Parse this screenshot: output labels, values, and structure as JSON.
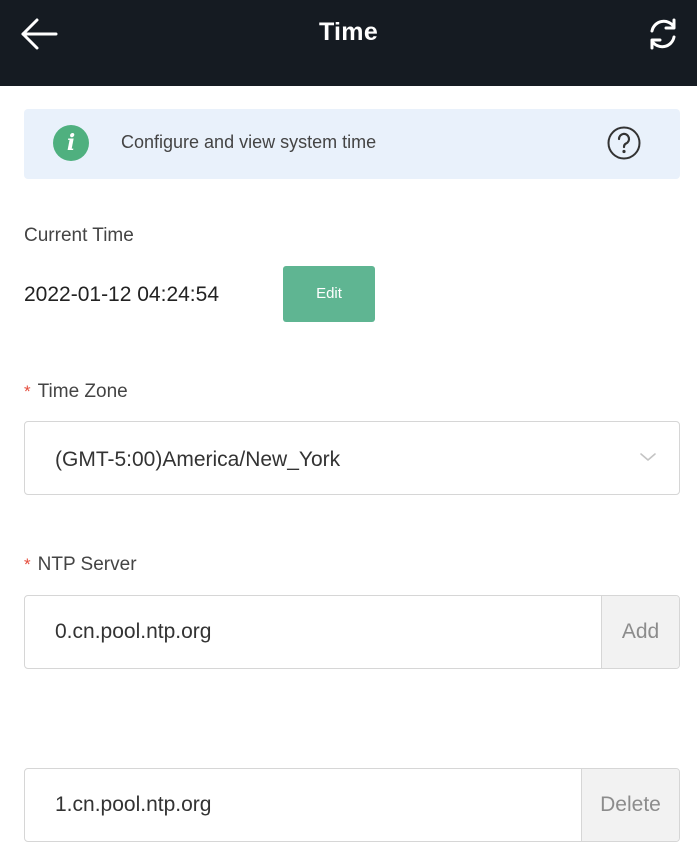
{
  "header": {
    "title": "Time",
    "back_icon": "arrow-left-icon",
    "refresh_icon": "refresh-icon"
  },
  "info_banner": {
    "text": "Configure and view system time",
    "info_icon_glyph": "i",
    "icon_color": "#4fb07f",
    "help_icon": "question-circle-icon"
  },
  "current_time": {
    "label": "Current Time",
    "value": "2022-01-12 04:24:54",
    "edit_label": "Edit"
  },
  "time_zone": {
    "required_mark": "*",
    "label": "Time Zone",
    "selected": "(GMT-5:00)America/New_York"
  },
  "ntp": {
    "required_mark": "*",
    "label": "NTP Server",
    "servers": [
      {
        "value": "0.cn.pool.ntp.org",
        "action_label": "Add"
      },
      {
        "value": "1.cn.pool.ntp.org",
        "action_label": "Delete"
      }
    ]
  },
  "colors": {
    "header_bg": "#151b22",
    "banner_bg": "#e9f1fb",
    "accent_green": "#5fb592",
    "required_red": "#e54c3c"
  }
}
